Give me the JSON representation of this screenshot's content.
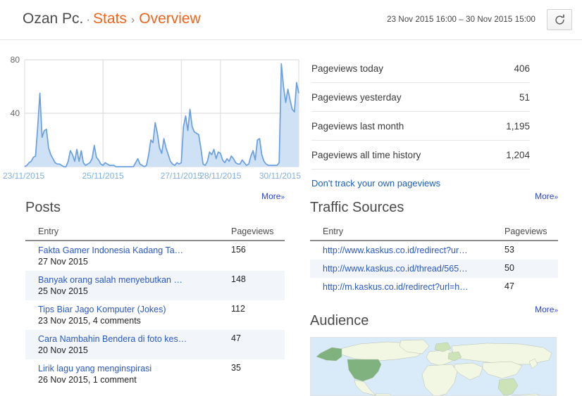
{
  "header": {
    "site": "Ozan Pc.",
    "sep_dot": "·",
    "stats_label": "Stats",
    "sep_arrow": "›",
    "current": "Overview",
    "date_range": "23 Nov 2015 16:00 – 30 Nov 2015 15:00",
    "refresh_icon": "refresh-icon"
  },
  "summary": {
    "rows": [
      {
        "label": "Pageviews today",
        "value": "406"
      },
      {
        "label": "Pageviews yesterday",
        "value": "51"
      },
      {
        "label": "Pageviews last month",
        "value": "1,195"
      },
      {
        "label": "Pageviews all time history",
        "value": "1,204"
      }
    ],
    "link": "Don't track your own pageviews"
  },
  "posts": {
    "title": "Posts",
    "more": "More",
    "more_chevron": "»",
    "columns": [
      "Entry",
      "Pageviews"
    ],
    "rows": [
      {
        "entry": "Fakta Gamer Indonesia Kadang Ta…",
        "meta": "27 Nov 2015",
        "views": "156"
      },
      {
        "entry": "Banyak orang salah menyebutkan …",
        "meta": "25 Nov 2015",
        "views": "148"
      },
      {
        "entry": "Tips Biar Jago Komputer (Jokes)",
        "meta": "23 Nov 2015, 4 comments",
        "views": "112"
      },
      {
        "entry": "Cara Nambahin Bendera di foto kes…",
        "meta": "20 Nov 2015",
        "views": "47"
      },
      {
        "entry": "Lirik lagu yang menginspirasi",
        "meta": "26 Nov 2015, 1 comment",
        "views": "35"
      }
    ]
  },
  "traffic": {
    "title": "Traffic Sources",
    "more": "More",
    "more_chevron": "»",
    "columns": [
      "Entry",
      "Pageviews"
    ],
    "rows": [
      {
        "entry": "http://www.kaskus.co.id/redirect?ur…",
        "views": "53"
      },
      {
        "entry": "http://www.kaskus.co.id/thread/565…",
        "views": "50"
      },
      {
        "entry": "http://m.kaskus.co.id/redirect?url=h…",
        "views": "47"
      }
    ]
  },
  "audience": {
    "title": "Audience",
    "more": "More",
    "more_chevron": "»",
    "map_name": "world-map",
    "ocean_color": "#d9eaf8",
    "land_color": "#f2f7e4",
    "highlight_strong": "#7fb27f",
    "highlight_light": "#cbe3b6"
  },
  "chart_data": {
    "type": "area",
    "title": "",
    "xlabel": "",
    "ylabel": "",
    "line_color": "#6a9fe0",
    "fill_color": "#cfe1f5",
    "grid": true,
    "ylim": [
      0,
      80
    ],
    "yticks": [
      40,
      80
    ],
    "ytick_labels": [
      "40",
      "80"
    ],
    "xtick_labels": [
      "23/11/2015",
      "25/11/2015",
      "27/11/2015",
      "28/11/2015",
      "30/11/2015"
    ],
    "xtick_positions": [
      0,
      24,
      48,
      60,
      84
    ],
    "x_unit": "hours since 23 Nov 2015 16:00",
    "x": [
      0,
      1,
      2,
      3,
      4,
      5,
      6,
      7,
      8,
      9,
      10,
      11,
      12,
      13,
      14,
      15,
      16,
      17,
      18,
      19,
      20,
      21,
      22,
      23,
      24,
      25,
      26,
      27,
      28,
      29,
      30,
      31,
      32,
      33,
      34,
      35,
      36,
      37,
      38,
      39,
      40,
      41,
      42,
      43,
      44,
      45,
      46,
      47,
      48,
      49,
      50,
      51,
      52,
      53,
      54,
      55,
      56,
      57,
      58,
      59,
      60,
      61,
      62,
      63,
      64,
      65,
      66,
      67,
      68,
      69,
      70,
      71,
      72,
      73,
      74,
      75,
      76,
      77,
      78,
      79,
      80,
      81,
      82,
      83,
      84,
      85,
      86,
      87,
      88,
      89,
      90,
      91
    ],
    "values": [
      0,
      1,
      3,
      4,
      7,
      8,
      30,
      55,
      22,
      27,
      28,
      14,
      9,
      6,
      3,
      2,
      2,
      1,
      0,
      0,
      4,
      12,
      9,
      4,
      13,
      4,
      12,
      3,
      1,
      2,
      3,
      6,
      16,
      7,
      5,
      2,
      1,
      3,
      2,
      1,
      1,
      1,
      0,
      0,
      0,
      0,
      0,
      0,
      0,
      0,
      0,
      3,
      6,
      2,
      1,
      0,
      1,
      9,
      20,
      18,
      33,
      25,
      14,
      10,
      21,
      14,
      9,
      4,
      2,
      1,
      3,
      2,
      3,
      30,
      38,
      27,
      43,
      30,
      26,
      25,
      24,
      14,
      2,
      1,
      4,
      11,
      9,
      13,
      6,
      11,
      10,
      5,
      3,
      6,
      4,
      8,
      6,
      3,
      2,
      2,
      5,
      3,
      1,
      2,
      8,
      12,
      5,
      20,
      21,
      9,
      4,
      2,
      1,
      1,
      1,
      1,
      1,
      3,
      77,
      60,
      48,
      58,
      50,
      43,
      41,
      63,
      55
    ],
    "series_note": "pageviews per hour"
  }
}
